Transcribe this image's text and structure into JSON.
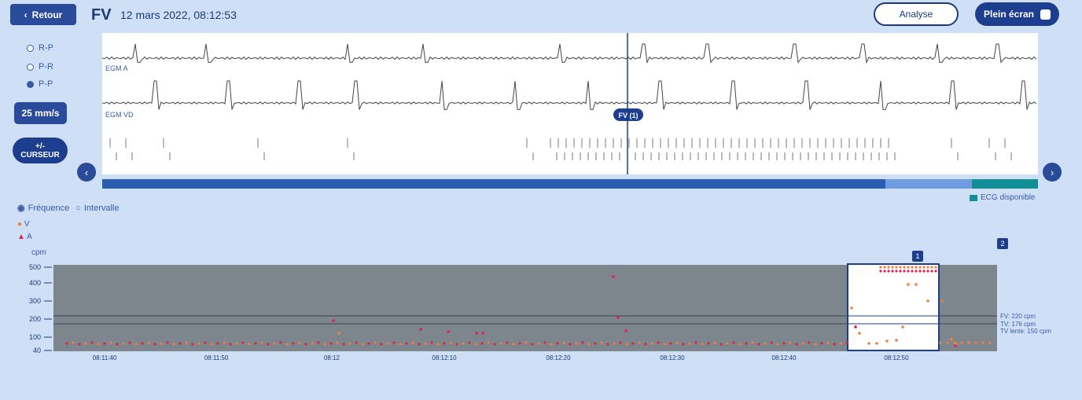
{
  "header": {
    "back_label": "Retour",
    "title": "FV",
    "datetime": "12 mars 2022, 08:12:53",
    "analyse_label": "Analyse",
    "fullscreen_label": "Plein écran"
  },
  "sidebar": {
    "radios": [
      {
        "label": "R-P",
        "checked": false
      },
      {
        "label": "P-R",
        "checked": false
      },
      {
        "label": "P-P",
        "checked": true
      }
    ],
    "speed_label": "25 mm/s",
    "cursor_line1": "+/-",
    "cursor_line2": "CURSEUR"
  },
  "ecg": {
    "channel1_label": "EGM A",
    "channel2_label": "EGM VD",
    "marker_label": "FV (1)"
  },
  "legend": {
    "ecg_available": "ECG disponible"
  },
  "trend": {
    "mode_frequency": "Fréquence",
    "mode_interval": "Intervalle",
    "series_a_label": "V",
    "series_b_label": "A",
    "unit_label": "cpm",
    "badge_1": "1",
    "badge_2": "2",
    "yticks": [
      "500",
      "400",
      "300",
      "200",
      "100",
      "40"
    ],
    "xticks": [
      "08:11:40",
      "08:11:50",
      "08:12",
      "08:12:10",
      "08:12:20",
      "08:12:30",
      "08:12:40",
      "08:12:50"
    ],
    "right_labels": [
      "FV: 220 cpm",
      "TV: 176 cpm",
      "TV lente: 150 cpm"
    ]
  },
  "colors": {
    "primary": "#1d3e8f",
    "accent_teal": "#138e95",
    "background": "#cfe0f6",
    "plot_bg": "#7d858d",
    "point_red": "#e02050",
    "point_orange": "#f08040"
  }
}
